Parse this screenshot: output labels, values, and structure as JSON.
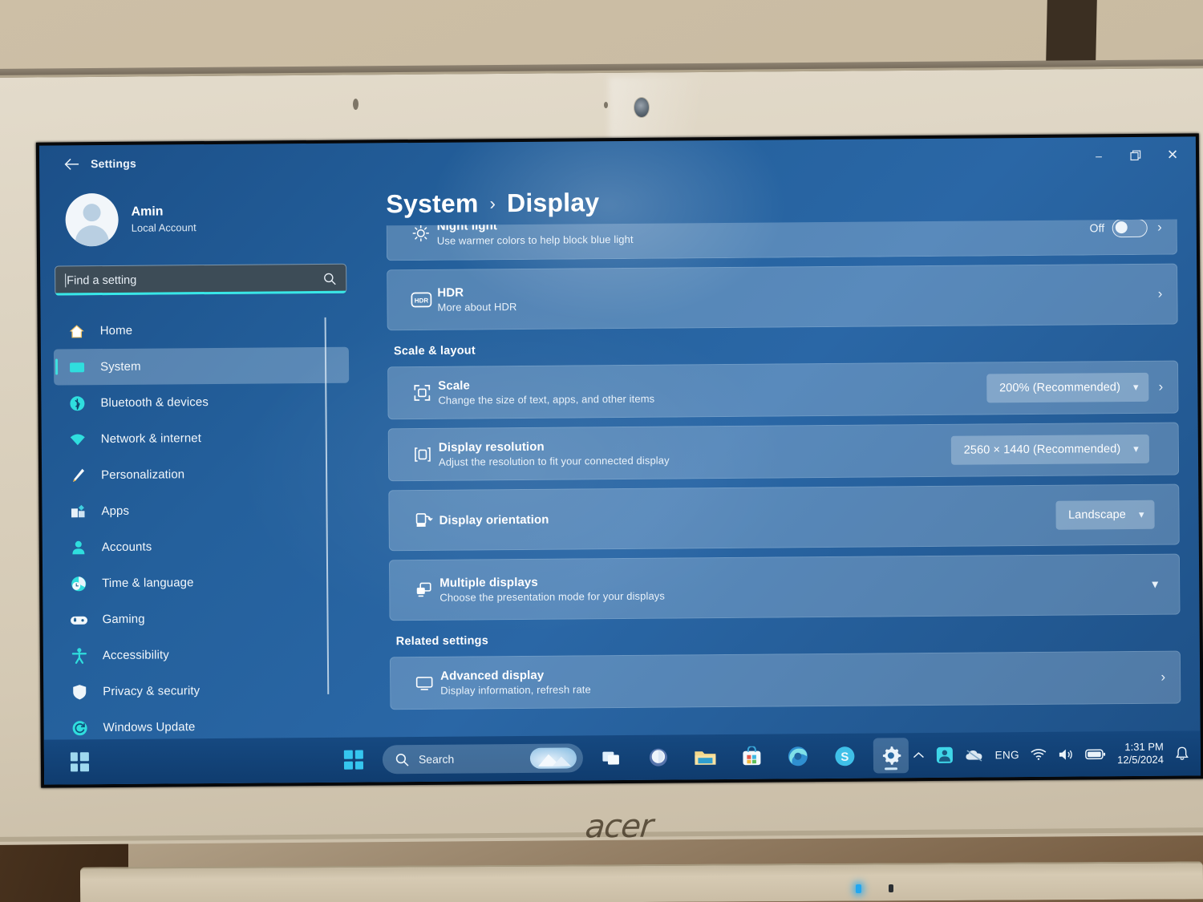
{
  "device": {
    "brand": "acer"
  },
  "window": {
    "title": "Settings",
    "back_icon": "back-arrow-icon",
    "controls": {
      "minimize": "–",
      "maximize": "❐",
      "close": "✕"
    }
  },
  "sidebar": {
    "account": {
      "name": "Amin",
      "type": "Local Account"
    },
    "search": {
      "placeholder": "Find a setting",
      "icon": "search-icon",
      "focused": true
    },
    "items": [
      {
        "label": "Home",
        "icon": "home-icon",
        "active": false
      },
      {
        "label": "System",
        "icon": "system-monitor-icon",
        "active": true
      },
      {
        "label": "Bluetooth & devices",
        "icon": "bluetooth-icon",
        "active": false
      },
      {
        "label": "Network & internet",
        "icon": "wifi-icon",
        "active": false
      },
      {
        "label": "Personalization",
        "icon": "paintbrush-icon",
        "active": false
      },
      {
        "label": "Apps",
        "icon": "apps-icon",
        "active": false
      },
      {
        "label": "Accounts",
        "icon": "person-icon",
        "active": false
      },
      {
        "label": "Time & language",
        "icon": "clock-icon",
        "active": false
      },
      {
        "label": "Gaming",
        "icon": "gamepad-icon",
        "active": false
      },
      {
        "label": "Accessibility",
        "icon": "accessibility-icon",
        "active": false
      },
      {
        "label": "Privacy & security",
        "icon": "shield-icon",
        "active": false
      },
      {
        "label": "Windows Update",
        "icon": "update-refresh-icon",
        "active": false
      }
    ]
  },
  "main": {
    "breadcrumb": {
      "root": "System",
      "separator": "›",
      "current": "Display"
    },
    "night_light": {
      "title": "Night light",
      "subtitle": "Use warmer colors to help block blue light",
      "icon": "night-light-sun-icon",
      "toggle_label": "Off",
      "toggle_state": "off"
    },
    "hdr": {
      "title": "HDR",
      "subtitle": "More about HDR",
      "icon": "hdr-badge-icon"
    },
    "scale_layout": {
      "heading": "Scale & layout",
      "scale": {
        "title": "Scale",
        "subtitle": "Change the size of text, apps, and other items",
        "icon": "scale-resize-icon",
        "value": "200% (Recommended)"
      },
      "resolution": {
        "title": "Display resolution",
        "subtitle": "Adjust the resolution to fit your connected display",
        "icon": "display-resolution-icon",
        "value": "2560 × 1440 (Recommended)"
      },
      "orientation": {
        "title": "Display orientation",
        "subtitle": "",
        "icon": "display-orientation-icon",
        "value": "Landscape"
      },
      "multiple_displays": {
        "title": "Multiple displays",
        "subtitle": "Choose the presentation mode for your displays",
        "icon": "multiple-displays-icon"
      }
    },
    "related_settings": {
      "heading": "Related settings",
      "advanced_display": {
        "title": "Advanced display",
        "subtitle": "Display information, refresh rate",
        "icon": "monitor-icon"
      }
    }
  },
  "taskbar": {
    "widgets_icon": "widgets-icon",
    "start_icon": "windows-start-icon",
    "search": {
      "placeholder": "Search",
      "icon": "search-icon"
    },
    "apps": [
      {
        "name": "task-view-icon",
        "label": "Task view"
      },
      {
        "name": "copilot-icon",
        "label": "Copilot"
      },
      {
        "name": "file-explorer-icon",
        "label": "File Explorer"
      },
      {
        "name": "microsoft-store-icon",
        "label": "Microsoft Store"
      },
      {
        "name": "edge-icon",
        "label": "Microsoft Edge"
      },
      {
        "name": "skype-icon",
        "label": "Skype"
      },
      {
        "name": "settings-gear-icon",
        "label": "Settings",
        "active": true
      }
    ],
    "tray": {
      "overflow_icon": "chevron-up-icon",
      "app_icon": "tray-app-icon",
      "onedrive_icon": "onedrive-offline-icon",
      "language": "ENG",
      "wifi_icon": "wifi-icon",
      "volume_icon": "speaker-icon",
      "battery_icon": "battery-icon",
      "time": "1:31 PM",
      "date": "12/5/2024",
      "notifications_icon": "bell-icon"
    }
  },
  "colors": {
    "desktop_blue": "#2a67a6",
    "card": "#3b7ab5",
    "accent_cyan": "#38e7e7",
    "taskbar": "#0e3a6c",
    "bezel": "#ddd4c2"
  }
}
